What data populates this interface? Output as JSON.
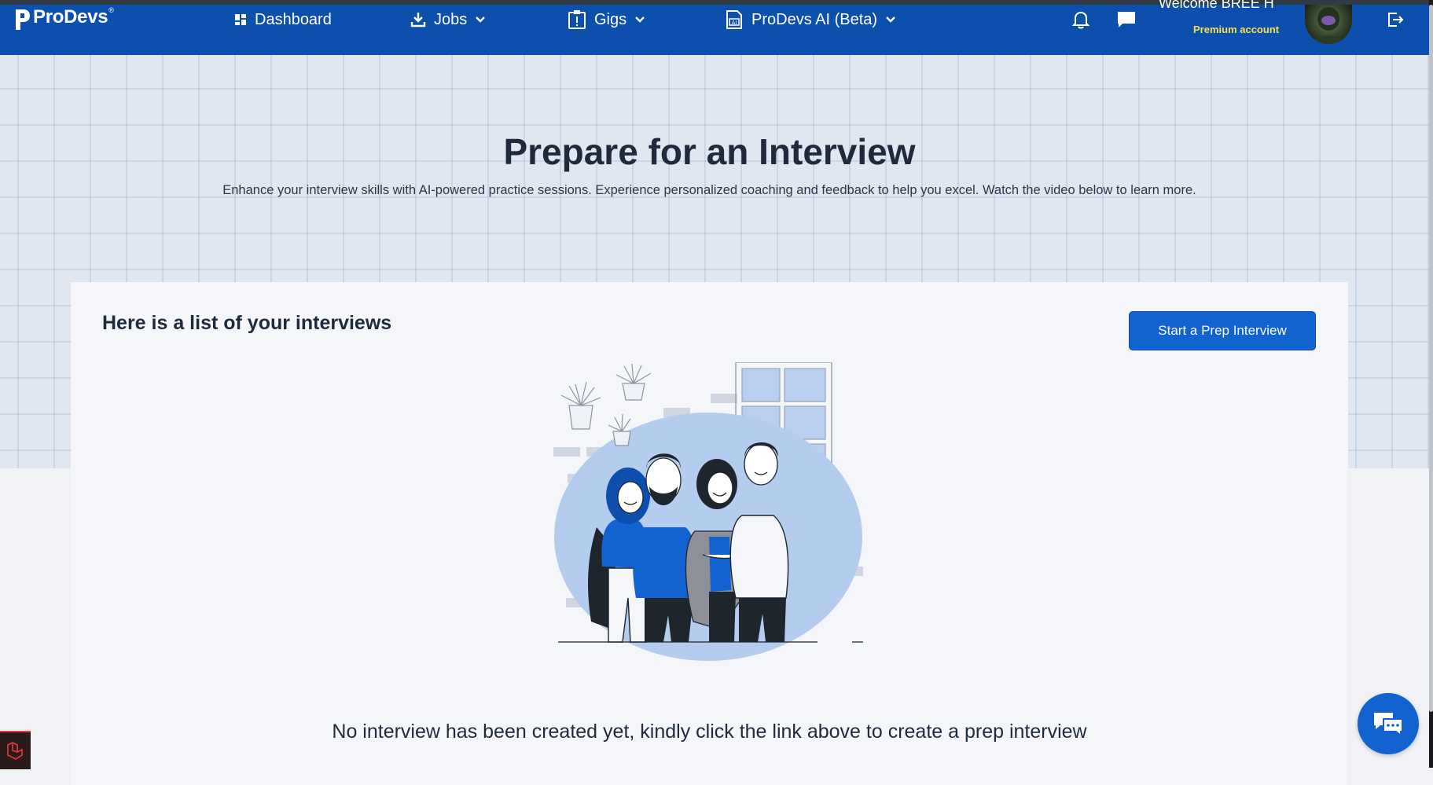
{
  "navbar": {
    "brand": "ProDevs",
    "brand_mark": "®",
    "items": [
      {
        "label": "Dashboard",
        "icon": "dashboard-icon"
      },
      {
        "label": "Jobs",
        "icon": "download-icon",
        "dropdown": true
      },
      {
        "label": "Gigs",
        "icon": "clipboard-alert-icon",
        "dropdown": true
      },
      {
        "label": "ProDevs AI (Beta)",
        "icon": "ai-document-icon",
        "dropdown": true
      }
    ],
    "welcome": "Welcome BREE H",
    "account_type": "Premium account",
    "icons": [
      "bell-icon",
      "message-icon",
      "avatar",
      "logout-icon"
    ]
  },
  "hero": {
    "title": "Prepare for an Interview",
    "subtitle": "Enhance your interview skills with AI-powered practice sessions. Experience personalized coaching and feedback to help you excel. Watch the video below to learn more."
  },
  "interviews": {
    "title": "Here is a list of your interviews",
    "start_button": "Start a Prep Interview",
    "empty_message": "No interview has been created yet, kindly click the link above to create a prep interview"
  },
  "colors": {
    "navbar": "#0d4fad",
    "accent": "#1262cf",
    "premium": "#f4e04d",
    "illustration_blob": "#b4cdee"
  }
}
